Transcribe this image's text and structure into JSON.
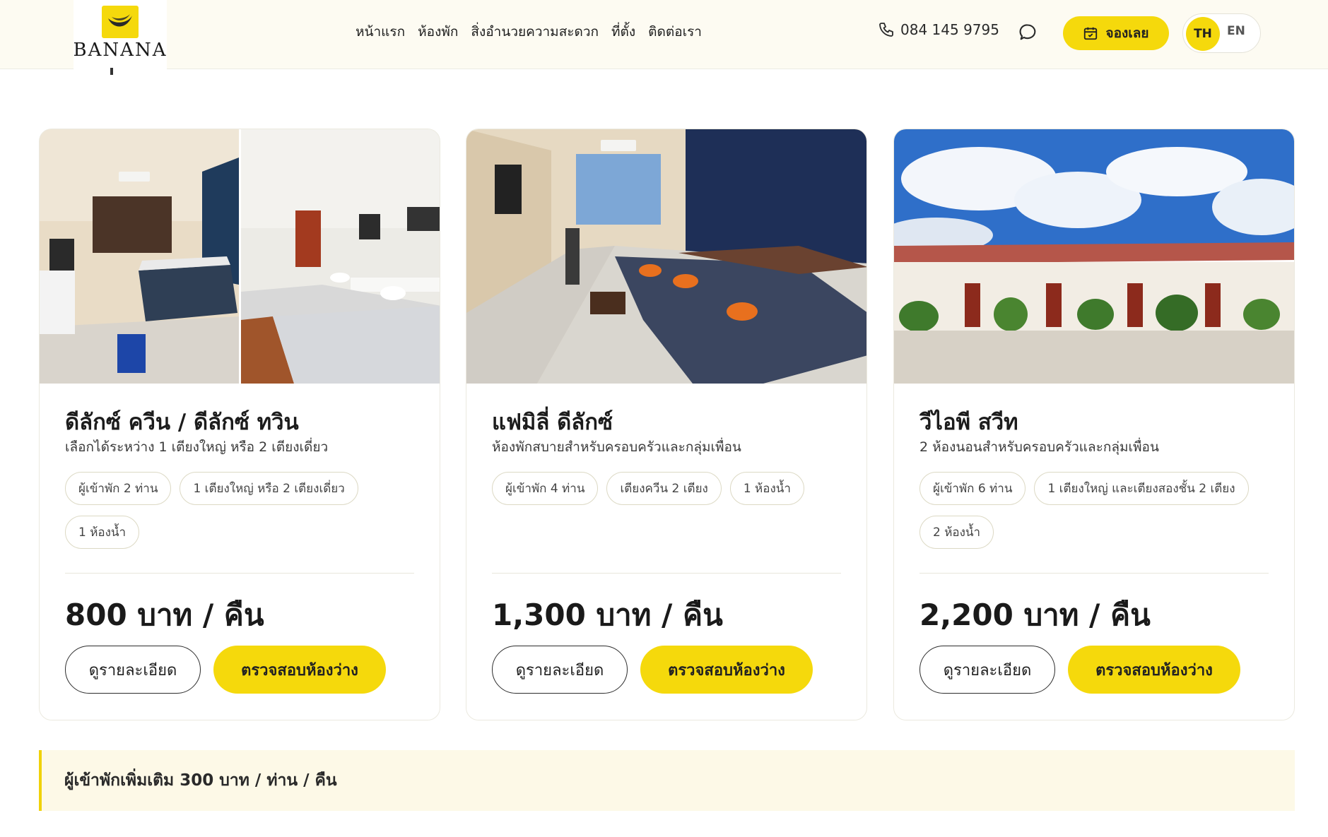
{
  "brand": {
    "name": "BANANA",
    "accent": "#f5d90c"
  },
  "nav": {
    "items": [
      "หน้าแรก",
      "ห้องพัก",
      "สิ่งอำนวยความสะดวก",
      "ที่ตั้ง",
      "ติดต่อเรา"
    ]
  },
  "contact": {
    "phone": "084 145 9795",
    "phone_icon": "phone-icon",
    "chat_icon": "chat-bubble-icon"
  },
  "book": {
    "label": "จองเลย",
    "icon": "calendar-icon"
  },
  "lang": {
    "th": "TH",
    "en": "EN",
    "selected": "TH"
  },
  "rooms": [
    {
      "title": "ดีลักซ์ ควีน / ดีลักซ์ ทวิน",
      "subtitle": "เลือกได้ระหว่าง 1 เตียงใหญ่ หรือ 2 เตียงเดี่ยว",
      "tags": [
        "ผู้เข้าพัก 2 ท่าน",
        "1 เตียงใหญ่ หรือ 2 เตียงเดี่ยว",
        "1 ห้องน้ำ"
      ],
      "price": "800 บาท / คืน",
      "detail_label": "ดูรายละเอียด",
      "check_label": "ตรวจสอบห้องว่าง"
    },
    {
      "title": "แฟมิลี่ ดีลักซ์",
      "subtitle": "ห้องพักสบายสำหรับครอบครัวและกลุ่มเพื่อน",
      "tags": [
        "ผู้เข้าพัก 4 ท่าน",
        "เตียงควีน 2 เตียง",
        "1 ห้องน้ำ"
      ],
      "price": "1,300 บาท / คืน",
      "detail_label": "ดูรายละเอียด",
      "check_label": "ตรวจสอบห้องว่าง"
    },
    {
      "title": "วีไอพี สวีท",
      "subtitle": "2 ห้องนอนสำหรับครอบครัวและกลุ่มเพื่อน",
      "tags": [
        "ผู้เข้าพัก 6 ท่าน",
        "1 เตียงใหญ่ และเตียงสองชั้น 2 เตียง",
        "2 ห้องน้ำ"
      ],
      "price": "2,200 บาท / คืน",
      "detail_label": "ดูรายละเอียด",
      "check_label": "ตรวจสอบห้องว่าง"
    }
  ],
  "notice": {
    "text": "ผู้เข้าพักเพิ่มเติม 300 บาท / ท่าน / คืน"
  }
}
